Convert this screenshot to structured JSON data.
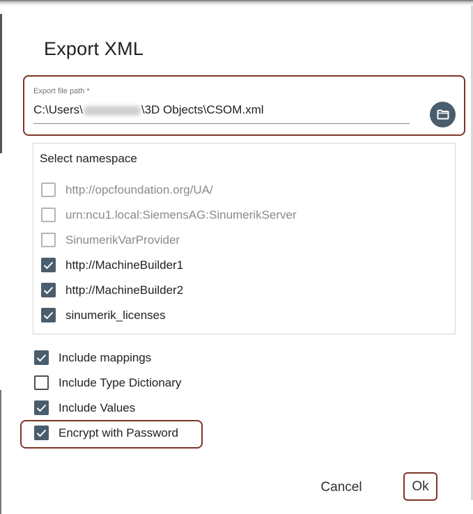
{
  "dialog": {
    "title": "Export XML"
  },
  "export_path": {
    "label": "Export file path *",
    "value_prefix": "C:\\Users\\",
    "value_suffix": "\\3D Objects\\CSOM.xml",
    "browse_icon": "folder-icon"
  },
  "namespaces": {
    "heading": "Select namespace",
    "items": [
      {
        "label": "http://opcfoundation.org/UA/",
        "checked": false,
        "disabled": true
      },
      {
        "label": "urn:ncu1.local:SiemensAG:SinumerikServer",
        "checked": false,
        "disabled": true
      },
      {
        "label": "SinumerikVarProvider",
        "checked": false,
        "disabled": true
      },
      {
        "label": "http://MachineBuilder1",
        "checked": true,
        "disabled": false
      },
      {
        "label": "http://MachineBuilder2",
        "checked": true,
        "disabled": false
      },
      {
        "label": "sinumerik_licenses",
        "checked": true,
        "disabled": false
      }
    ]
  },
  "options": {
    "items": [
      {
        "label": "Include mappings",
        "checked": true
      },
      {
        "label": "Include Type Dictionary",
        "checked": false
      },
      {
        "label": "Include Values",
        "checked": true
      },
      {
        "label": "Encrypt with Password",
        "checked": true
      }
    ]
  },
  "actions": {
    "cancel_label": "Cancel",
    "ok_label": "Ok"
  },
  "colors": {
    "accent": "#4a5d6d",
    "highlight": "#7d3428"
  }
}
